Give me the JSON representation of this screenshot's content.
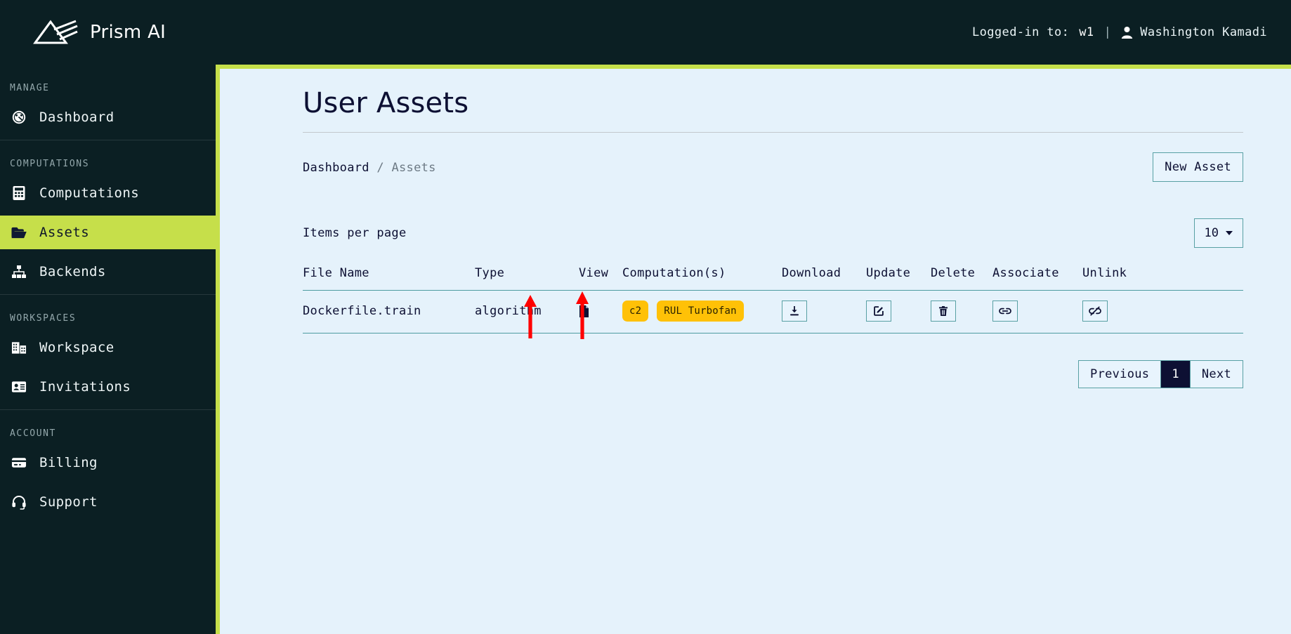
{
  "app": {
    "brand_name": "Prism AI",
    "logo_icon": "prism-logo-icon"
  },
  "header": {
    "logged_in_label": "Logged-in to:",
    "workspace": "w1",
    "separator": "|",
    "user_icon": "user-icon",
    "user_name": "Washington Kamadi"
  },
  "sidebar": {
    "sections": [
      {
        "caption": "MANAGE",
        "items": [
          {
            "label": "Dashboard",
            "icon": "dashboard-gauge-icon",
            "active": false
          }
        ]
      },
      {
        "caption": "COMPUTATIONS",
        "items": [
          {
            "label": "Computations",
            "icon": "calculator-icon",
            "active": false
          },
          {
            "label": "Assets",
            "icon": "folder-icon",
            "active": true
          },
          {
            "label": "Backends",
            "icon": "sitemap-icon",
            "active": false
          }
        ]
      },
      {
        "caption": "WORKSPACES",
        "items": [
          {
            "label": "Workspace",
            "icon": "building-icon",
            "active": false
          },
          {
            "label": "Invitations",
            "icon": "id-card-icon",
            "active": false
          }
        ]
      },
      {
        "caption": "ACCOUNT",
        "items": [
          {
            "label": "Billing",
            "icon": "credit-card-icon",
            "active": false
          },
          {
            "label": "Support",
            "icon": "headset-icon",
            "active": false
          }
        ]
      }
    ]
  },
  "main": {
    "page_title": "User Assets",
    "breadcrumb": {
      "root": "Dashboard",
      "separator": "/",
      "current": "Assets"
    },
    "new_asset_label": "New Asset",
    "items_per_page_label": "Items per page",
    "items_per_page_value": "10",
    "table": {
      "headers": [
        "File Name",
        "Type",
        "View",
        "Computation(s)",
        "Download",
        "Update",
        "Delete",
        "Associate",
        "Unlink"
      ],
      "rows": [
        {
          "file_name": "Dockerfile.train",
          "type": "algorithm",
          "view_icon": "file-document-icon",
          "computations": [
            "c2",
            "RUL Turbofan"
          ],
          "download_icon": "download-icon",
          "update_icon": "edit-pencil-icon",
          "delete_icon": "trash-icon",
          "associate_icon": "link-icon",
          "unlink_icon": "unlink-icon"
        }
      ]
    },
    "pagination": {
      "previous_label": "Previous",
      "current_page": "1",
      "next_label": "Next"
    },
    "annotations": [
      {
        "name": "arrow-pointing-to-c2-badge",
        "color": "#ff0000"
      },
      {
        "name": "arrow-pointing-to-rul-turbofan-badge",
        "color": "#ff0000"
      }
    ]
  },
  "colors": {
    "sidebar_bg": "#0b1f23",
    "accent_lime": "#c6df4a",
    "panel_bg": "#e5f2fb",
    "badge_amber": "#ffc107",
    "navy": "#0d1033",
    "teal_border": "#58a0a4",
    "annotation_red": "#ff0000"
  }
}
